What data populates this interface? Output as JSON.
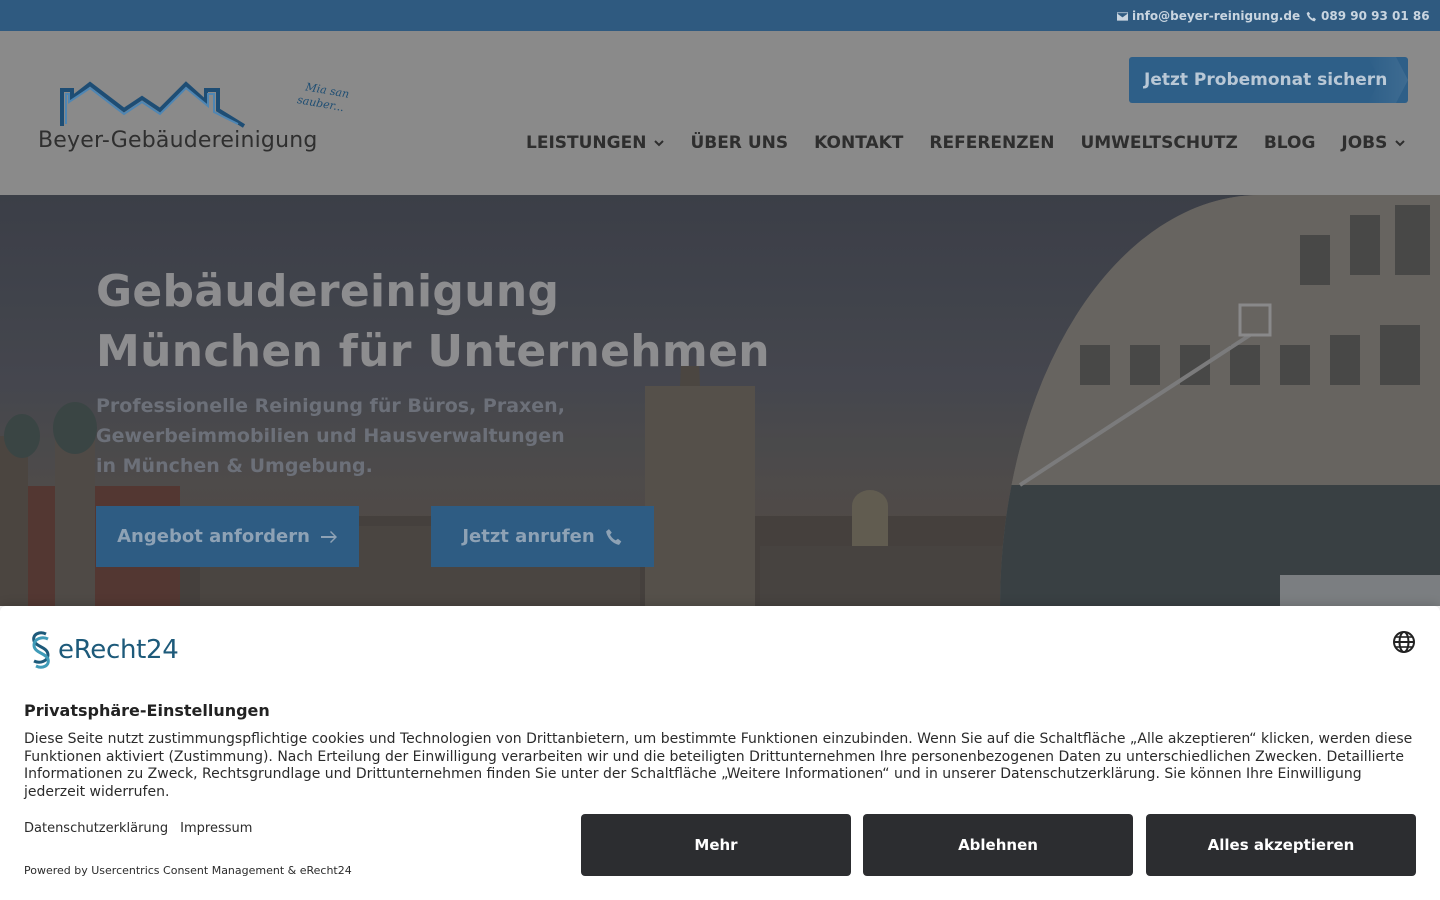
{
  "topbar": {
    "email": "info@beyer-reinigung.de",
    "phone": "089 90 93 01 86",
    "email_icon": "envelope-icon",
    "phone_icon": "phone-icon"
  },
  "header": {
    "logo_text": "Beyer-Gebäudereinigung",
    "logo_tagline_1": "Mia san",
    "logo_tagline_2": "sauber...",
    "promo_button": "Jetzt Probemonat sichern",
    "nav": [
      {
        "label": "LEISTUNGEN",
        "has_dropdown": true
      },
      {
        "label": "ÜBER UNS",
        "has_dropdown": false
      },
      {
        "label": "KONTAKT",
        "has_dropdown": false
      },
      {
        "label": "REFERENZEN",
        "has_dropdown": false
      },
      {
        "label": "UMWELTSCHUTZ",
        "has_dropdown": false
      },
      {
        "label": "BLOG",
        "has_dropdown": false
      },
      {
        "label": "JOBS",
        "has_dropdown": true
      }
    ]
  },
  "hero": {
    "title_line_1": "Gebäudereinigung",
    "title_line_2": "München für Unternehmen",
    "subtitle_line_1": "Professionelle Reinigung für Büros, Praxen,",
    "subtitle_line_2": "Gewerbeimmobilien und Hausverwaltungen",
    "subtitle_line_3": "in München & Umgebung.",
    "btn_offer": "Angebot anfordern",
    "btn_offer_icon": "arrow-right-icon",
    "btn_call": "Jetzt anrufen",
    "btn_call_icon": "phone-icon"
  },
  "consent": {
    "brand": "eRecht24",
    "title": "Privatsphäre-Einstellungen",
    "text": "Diese Seite nutzt zustimmungspflichtige cookies und Technologien von Drittanbietern, um bestimmte Funktionen einzubinden. Wenn Sie auf die Schaltfläche „Alle akzeptieren“ klicken, werden diese Funktionen aktiviert (Zustimmung). Nach Erteilung der Einwilligung verarbeiten wir und die beteiligten Drittunternehmen Ihre personenbezogenen Daten zu unterschiedlichen Zwecken. Detaillierte Informationen zu Zweck, Rechtsgrundlage und Drittunternehmen finden Sie unter der Schaltfläche „Weitere Informationen“ und in unserer Datenschutzerklärung. Sie können Ihre Einwilligung jederzeit widerrufen.",
    "link_privacy": "Datenschutzerklärung",
    "link_imprint": "Impressum",
    "powered_by": "Powered by Usercentrics Consent Management & eRecht24",
    "btn_more": "Mehr",
    "btn_reject": "Ablehnen",
    "btn_accept": "Alles akzeptieren",
    "language_icon": "globe-icon"
  },
  "colors": {
    "topbar": "#2f5a80",
    "primary_button": "#2e5c83",
    "consent_button": "#2c2d30",
    "brand_teal": "#1d5a7a"
  }
}
